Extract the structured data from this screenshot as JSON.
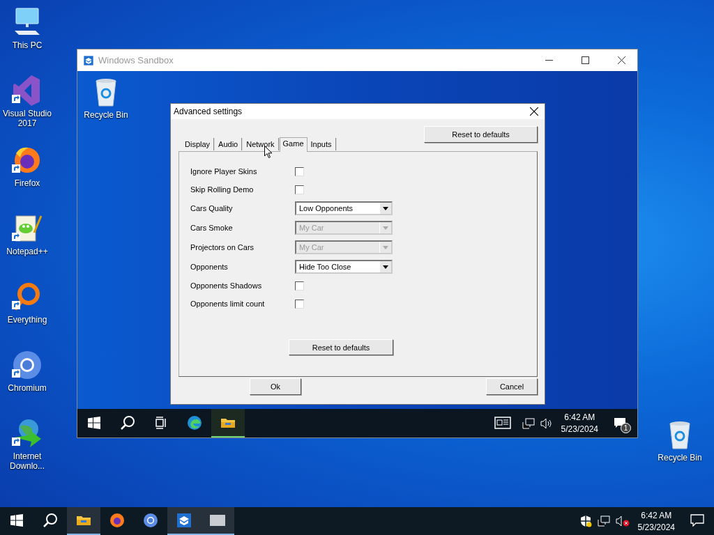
{
  "desktop": {
    "icons": [
      {
        "kind": "computer",
        "label": "This PC",
        "shortcut": false
      },
      {
        "kind": "studio",
        "label": "Visual Studio 2017",
        "shortcut": true
      },
      {
        "kind": "fox",
        "label": "Firefox",
        "shortcut": true
      },
      {
        "kind": "notepad",
        "label": "Notepad++",
        "shortcut": true
      },
      {
        "kind": "magnifier",
        "label": "Everything",
        "shortcut": true
      },
      {
        "kind": "chromium",
        "label": "Chromium",
        "shortcut": true
      },
      {
        "kind": "globe",
        "label": "Internet Downlo...",
        "shortcut": true
      }
    ],
    "right_icons": [
      {
        "kind": "bin",
        "label": "Recycle Bin",
        "shortcut": false
      }
    ]
  },
  "sandbox_window": {
    "title": "Windows Sandbox",
    "desktop_icons": [
      {
        "kind": "bin",
        "label": "Recycle Bin",
        "shortcut": false
      }
    ],
    "dialog": {
      "title": "Advanced settings",
      "tabs": [
        {
          "label": "Display",
          "selected": false
        },
        {
          "label": "Audio",
          "selected": false
        },
        {
          "label": "Network",
          "selected": false
        },
        {
          "label": "Game",
          "selected": true
        },
        {
          "label": "Inputs",
          "selected": false
        }
      ],
      "top_button": "Reset to defaults",
      "settings": [
        {
          "kind": "checkbox",
          "label": "Ignore Player Skins",
          "checked": false
        },
        {
          "kind": "checkbox",
          "label": "Skip Rolling Demo",
          "checked": false
        },
        {
          "kind": "dropdown",
          "label": "Cars Quality",
          "value": "Low Opponents",
          "disabled": false
        },
        {
          "kind": "dropdown",
          "label": "Cars Smoke",
          "value": "My Car",
          "disabled": true
        },
        {
          "kind": "dropdown",
          "label": "Projectors on Cars",
          "value": "My Car",
          "disabled": true
        },
        {
          "kind": "dropdown",
          "label": "Opponents",
          "value": "Hide Too Close",
          "disabled": false
        },
        {
          "kind": "checkbox",
          "label": "Opponents Shadows",
          "checked": false
        },
        {
          "kind": "checkbox",
          "label": "Opponents limit count",
          "checked": false
        }
      ],
      "panel_button": "Reset to defaults",
      "ok_button": "Ok",
      "cancel_button": "Cancel"
    },
    "taskbar": {
      "apps": [
        {
          "kind": "edge",
          "active": false
        },
        {
          "kind": "folder",
          "active": true
        }
      ],
      "clock_time": "6:42 AM",
      "clock_date": "5/23/2024",
      "notification_count": "1"
    }
  },
  "taskbar": {
    "apps": [
      {
        "kind": "folder",
        "active": true
      },
      {
        "kind": "fox",
        "active": false
      },
      {
        "kind": "chromium",
        "active": false
      },
      {
        "kind": "sandbox",
        "active": true
      },
      {
        "kind": "generic",
        "active": true
      }
    ],
    "clock_time": "6:42 AM",
    "clock_date": "5/23/2024"
  }
}
